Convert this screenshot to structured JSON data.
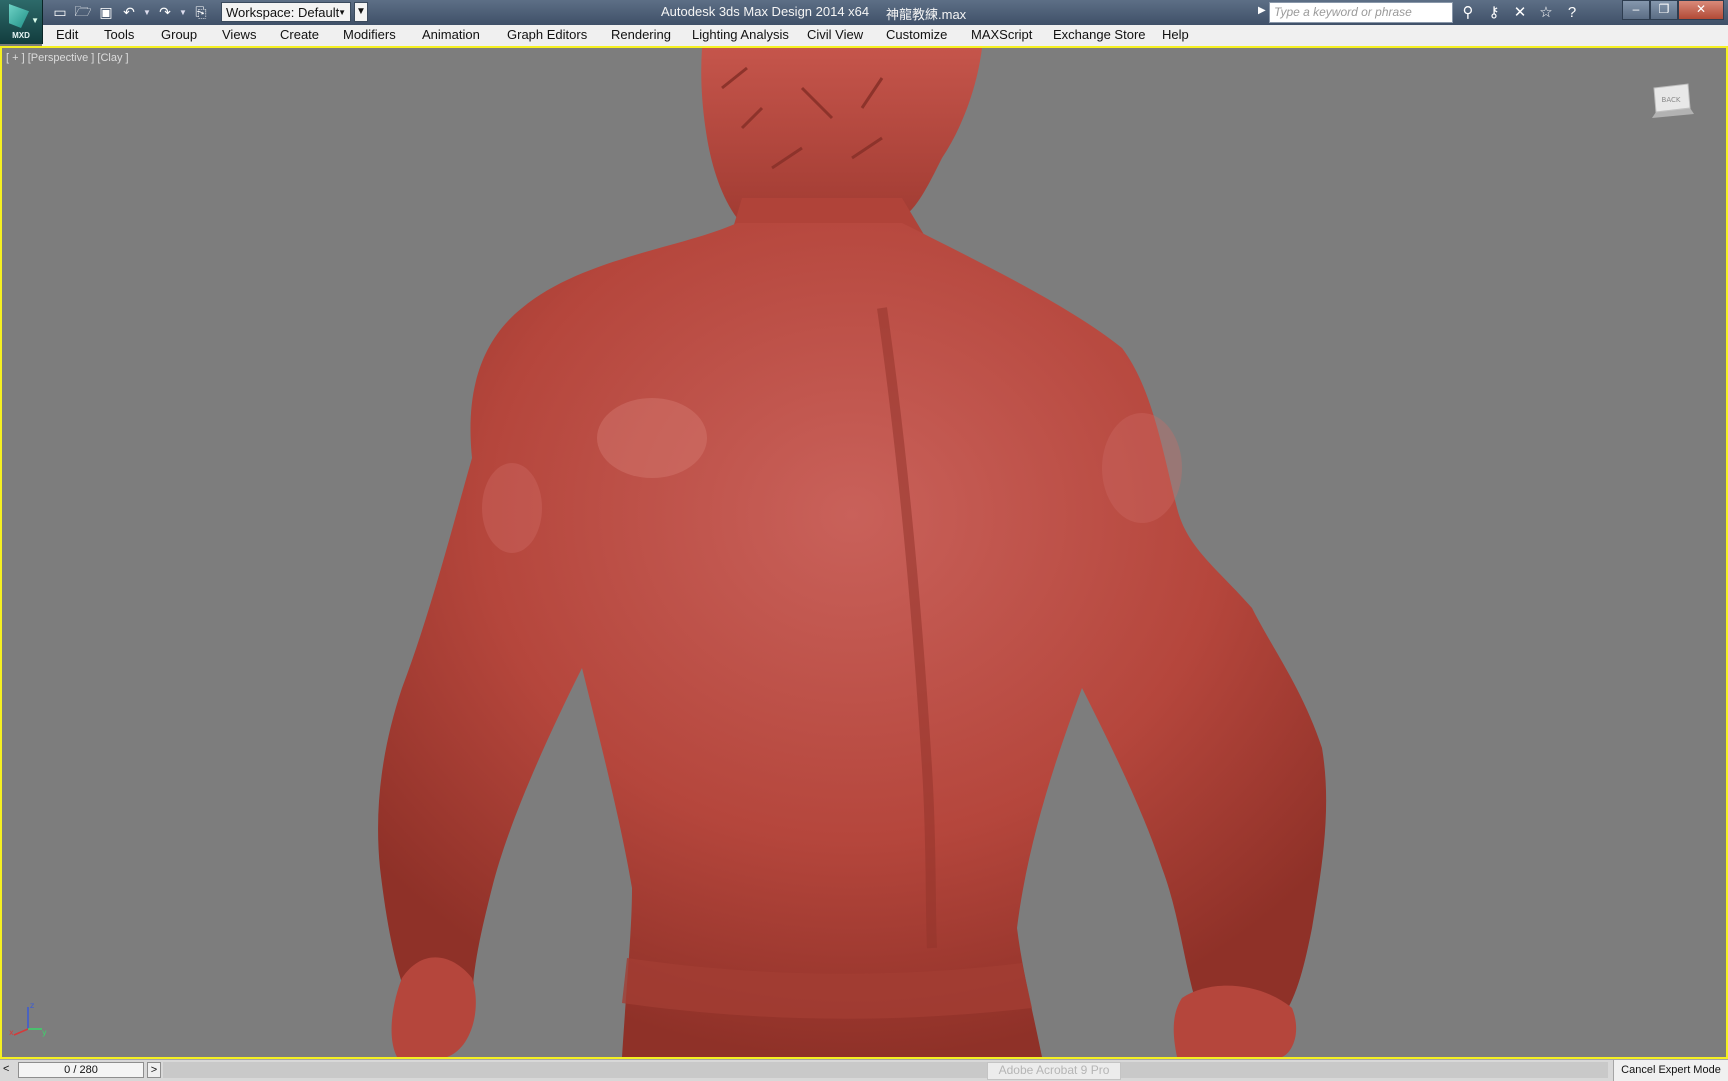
{
  "app": {
    "logo_text": "MXD",
    "title": "Autodesk 3ds Max Design 2014 x64",
    "file_name": "神龍教練.max",
    "workspace": "Workspace: Default"
  },
  "quick_access": {
    "icons": [
      "new-file-icon",
      "open-folder-icon",
      "save-icon",
      "undo-icon",
      "redo-icon",
      "project-folder-icon"
    ]
  },
  "search": {
    "placeholder": "Type a keyword or phrase"
  },
  "title_icons": [
    "binoculars-icon",
    "subscription-key-icon",
    "communication-icon",
    "favorites-star-icon",
    "help-icon"
  ],
  "menu": {
    "items": [
      "Edit",
      "Tools",
      "Group",
      "Views",
      "Create",
      "Modifiers",
      "Animation",
      "Graph Editors",
      "Rendering",
      "Lighting Analysis",
      "Civil View",
      "Customize",
      "MAXScript",
      "Exchange Store",
      "Help"
    ]
  },
  "viewport": {
    "label": "[ + ] [Perspective ] [Clay ]",
    "border_color": "#f5f021",
    "background": "#7d7d7d",
    "model_color": "#b5463c",
    "viewcube_text": "BACK"
  },
  "statusbar": {
    "time_prev": "<",
    "time_slider": "0 / 280",
    "time_next": ">",
    "taskbar_ghost": "Adobe Acrobat 9 Pro",
    "cancel_expert": "Cancel Expert Mode"
  }
}
